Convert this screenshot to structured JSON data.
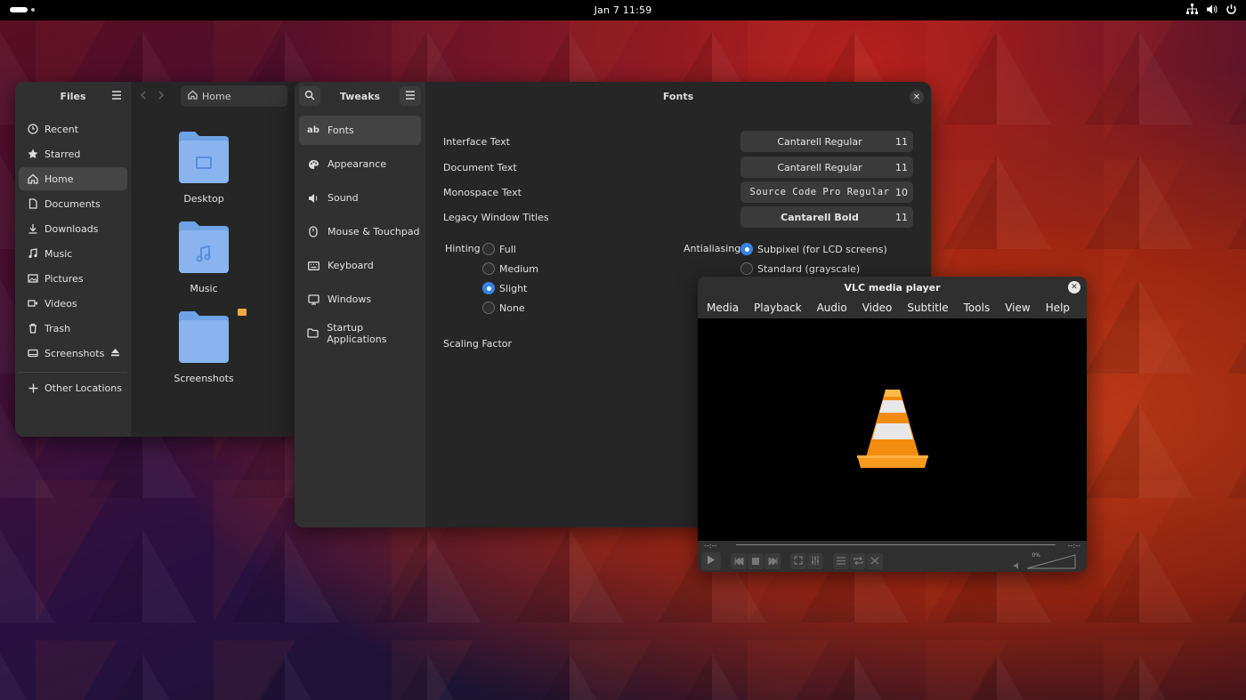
{
  "topbar": {
    "clock": "Jan 7  11:59"
  },
  "files": {
    "title": "Files",
    "path": "Home",
    "sidebar": [
      {
        "label": "Recent",
        "icon": "clock-icon"
      },
      {
        "label": "Starred",
        "icon": "star-icon"
      },
      {
        "label": "Home",
        "icon": "home-icon",
        "active": true
      },
      {
        "label": "Documents",
        "icon": "document-icon"
      },
      {
        "label": "Downloads",
        "icon": "download-icon"
      },
      {
        "label": "Music",
        "icon": "music-icon"
      },
      {
        "label": "Pictures",
        "icon": "picture-icon"
      },
      {
        "label": "Videos",
        "icon": "video-icon"
      },
      {
        "label": "Trash",
        "icon": "trash-icon"
      },
      {
        "label": "Screenshots",
        "icon": "drive-icon"
      }
    ],
    "other_locations": "Other Locations",
    "folders": [
      {
        "label": "Desktop"
      },
      {
        "label": "Music"
      },
      {
        "label": "Screenshots"
      }
    ]
  },
  "tweaks": {
    "title": "Tweaks",
    "page_title": "Fonts",
    "sidebar": [
      {
        "label": "Fonts",
        "icon": "ab"
      },
      {
        "label": "Appearance",
        "icon": "palette-icon"
      },
      {
        "label": "Sound",
        "icon": "speaker-icon"
      },
      {
        "label": "Mouse & Touchpad",
        "icon": "mouse-icon"
      },
      {
        "label": "Keyboard",
        "icon": "keyboard-icon"
      },
      {
        "label": "Windows",
        "icon": "window-icon"
      },
      {
        "label": "Startup Applications",
        "icon": "folder-icon"
      }
    ],
    "fonts": [
      {
        "label": "Interface Text",
        "font": "Cantarell Regular",
        "size": "11"
      },
      {
        "label": "Document Text",
        "font": "Cantarell Regular",
        "size": "11"
      },
      {
        "label": "Monospace Text",
        "font": "Source Code Pro Regular",
        "size": "10"
      },
      {
        "label": "Legacy Window Titles",
        "font": "Cantarell Bold",
        "size": "11"
      }
    ],
    "hinting": {
      "label": "Hinting",
      "options": [
        "Full",
        "Medium",
        "Slight",
        "None"
      ],
      "selected": "Slight"
    },
    "antialiasing": {
      "label": "Antialiasing",
      "options": [
        "Subpixel (for LCD screens)",
        "Standard (grayscale)"
      ],
      "selected": "Subpixel (for LCD screens)"
    },
    "scaling_label": "Scaling Factor"
  },
  "vlc": {
    "title": "VLC media player",
    "menu": [
      "Media",
      "Playback",
      "Audio",
      "Video",
      "Subtitle",
      "Tools",
      "View",
      "Help"
    ],
    "time_elapsed": "--:--",
    "time_total": "--:--",
    "volume_label": "0%"
  },
  "colors": {
    "accent": "#3584e4",
    "folder": "#8ab4f0",
    "vlc_orange": "#f28c10"
  }
}
